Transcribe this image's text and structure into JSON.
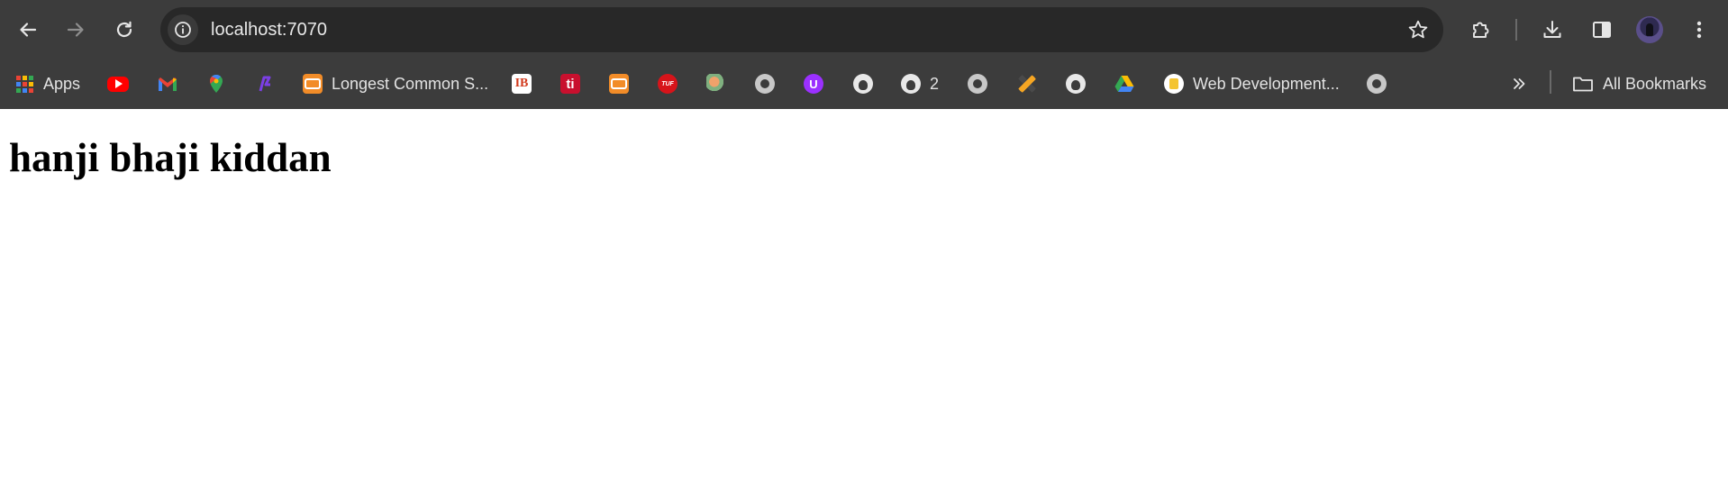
{
  "browser": {
    "address_bar": {
      "url": "localhost:7070"
    },
    "toolbar_icons": [
      "back-arrow-icon",
      "forward-arrow-icon",
      "reload-icon",
      "site-info-icon",
      "bookmark-star-icon",
      "extensions-puzzle-icon",
      "download-icon",
      "side-panel-icon",
      "profile-avatar",
      "more-vertical-icon"
    ]
  },
  "bookmarks": {
    "items": [
      {
        "label": "Apps",
        "icon": "apps-grid-icon"
      },
      {
        "label": "",
        "icon": "youtube-icon"
      },
      {
        "label": "",
        "icon": "gmail-icon"
      },
      {
        "label": "",
        "icon": "google-maps-icon"
      },
      {
        "label": "",
        "icon": "purple-logo-icon"
      },
      {
        "label": "Longest Common S...",
        "icon": "orange-code-icon"
      },
      {
        "label": "",
        "icon": "ib-icon"
      },
      {
        "label": "",
        "icon": "ti-icon"
      },
      {
        "label": "",
        "icon": "orange-code-icon"
      },
      {
        "label": "",
        "icon": "tuf-icon"
      },
      {
        "label": "",
        "icon": "balloon-icon"
      },
      {
        "label": "",
        "icon": "globe-icon"
      },
      {
        "label": "",
        "icon": "u-logo-icon"
      },
      {
        "label": "",
        "icon": "github-icon"
      },
      {
        "label": "2",
        "icon": "github-icon"
      },
      {
        "label": "",
        "icon": "globe-icon"
      },
      {
        "label": "",
        "icon": "sprite-icon"
      },
      {
        "label": "",
        "icon": "github-icon"
      },
      {
        "label": "",
        "icon": "google-drive-icon"
      },
      {
        "label": "Web Development...",
        "icon": "web-dev-icon"
      },
      {
        "label": "",
        "icon": "globe-icon"
      }
    ],
    "overflow_icon": "chevron-double-right-icon",
    "all_bookmarks": {
      "label": "All Bookmarks",
      "icon": "folder-icon"
    }
  },
  "page": {
    "heading": "hanji bhaji kiddan"
  },
  "colors": {
    "toolbar_bg": "#3c3c3c",
    "omnibox_bg": "#282828",
    "page_bg": "#ffffff",
    "heading_text": "#000000"
  }
}
